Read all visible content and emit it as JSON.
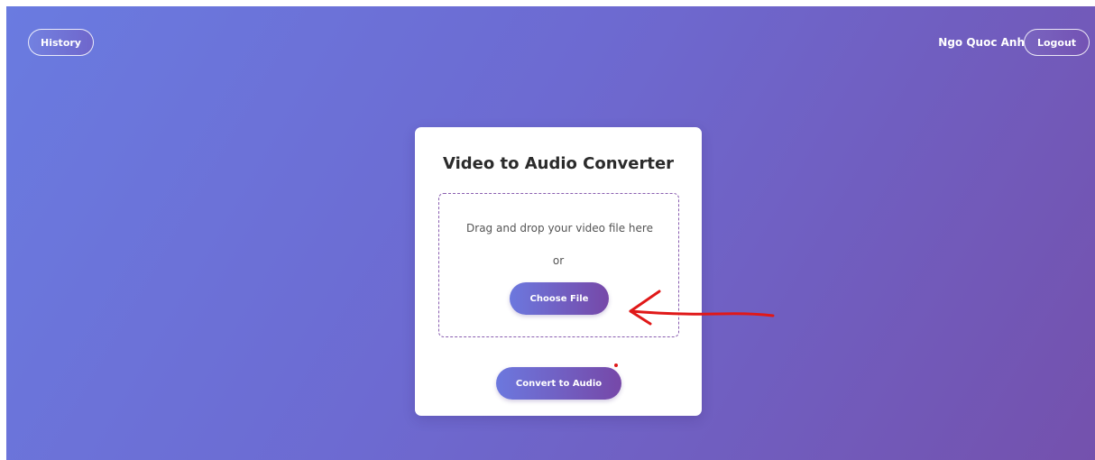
{
  "header": {
    "history_label": "History",
    "user_name": "Ngo Quoc Anh",
    "logout_label": "Logout"
  },
  "converter": {
    "title": "Video to Audio Converter",
    "drop_text": "Drag and drop your video file here",
    "or_text": "or",
    "choose_label": "Choose File",
    "convert_label": "Convert to Audio"
  },
  "colors": {
    "gradient_start": "#6a7be0",
    "gradient_end": "#7451ad",
    "annotation_red": "#e01818"
  }
}
